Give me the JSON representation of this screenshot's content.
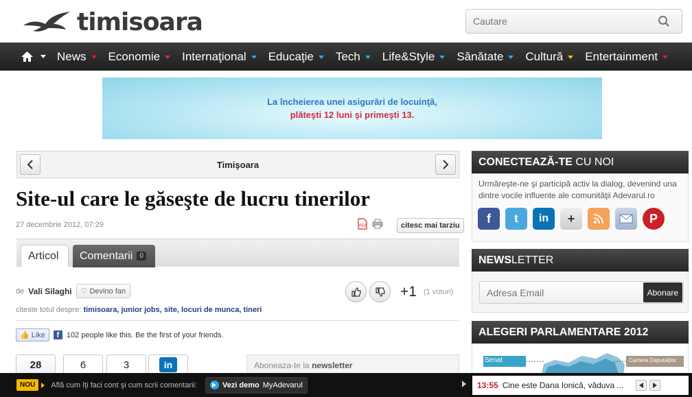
{
  "header": {
    "logo_text": "timisoara",
    "search_placeholder": "Cautare"
  },
  "nav": {
    "items": [
      {
        "label": "News",
        "color": "#e01b24"
      },
      {
        "label": "Economie",
        "color": "#e0237a"
      },
      {
        "label": "Internaţional",
        "color": "#2aa7e8"
      },
      {
        "label": "Educaţie",
        "color": "#2aa7e8"
      },
      {
        "label": "Tech",
        "color": "#2aa7e8"
      },
      {
        "label": "Life&Style",
        "color": "#2aa7e8"
      },
      {
        "label": "Sănătate",
        "color": "#2aa7e8"
      },
      {
        "label": "Cultură",
        "color": "#f5b800"
      },
      {
        "label": "Entertainment",
        "color": "#e01b24"
      }
    ]
  },
  "banner": {
    "line1": "La încheierea unei asigurări de locuinţă,",
    "line2": "plăteşti 12 luni şi primeşti 13."
  },
  "section": {
    "title": "Timişoara"
  },
  "article": {
    "title": "Site-ul care le găseşte de lucru tinerilor",
    "date": "27 decembrie 2012, 07:29",
    "read_later": "citesc mai tarziu",
    "tabs": {
      "article": "Articol",
      "comments": "Comentarii",
      "comments_count": "0"
    },
    "author_prefix": "de",
    "author": "Vali Silaghi",
    "fan_button": "Devino fan",
    "score": "+1",
    "votes": "(1 voturi)",
    "tags_label": "citeste totul despre:",
    "tags": [
      "timisoara",
      "junior jobs",
      "site",
      "locuri de munca",
      "tineri"
    ],
    "like_button": "Like",
    "likes_text": "102 people like this. Be the first of your friends.",
    "share_counts": [
      "28",
      "6",
      "3"
    ],
    "newsletter_prefix": "Aboneaza-te la",
    "newsletter_word": "newsletter"
  },
  "sidebar": {
    "connect": {
      "title_bold": "CONECTEAZĂ-TE",
      "title_light": "CU NOI",
      "text": "Urmăreşte-ne şi participă activ la dialog, devenind una dintre vocile influente ale comunităţii Adevarul.ro"
    },
    "newsletter": {
      "title_bold": "NEWS",
      "title_light": "LETTER",
      "email_placeholder": "Adresa Email",
      "button": "Abonare"
    },
    "elections": {
      "title": "ALEGERI PARLAMENTARE 2012",
      "label_left": "Senat",
      "label_right": "Camera Deputaţilor"
    }
  },
  "bottom_bar": {
    "badge": "NOU",
    "message": "Află cum îţi faci cont şi cum scrii comentarii:",
    "demo_label": "Vezi demo",
    "demo_brand": "MyAdevarul",
    "ticker_time": "13:55",
    "ticker_text": "Cine este Dana Ionică, văduva ..."
  }
}
